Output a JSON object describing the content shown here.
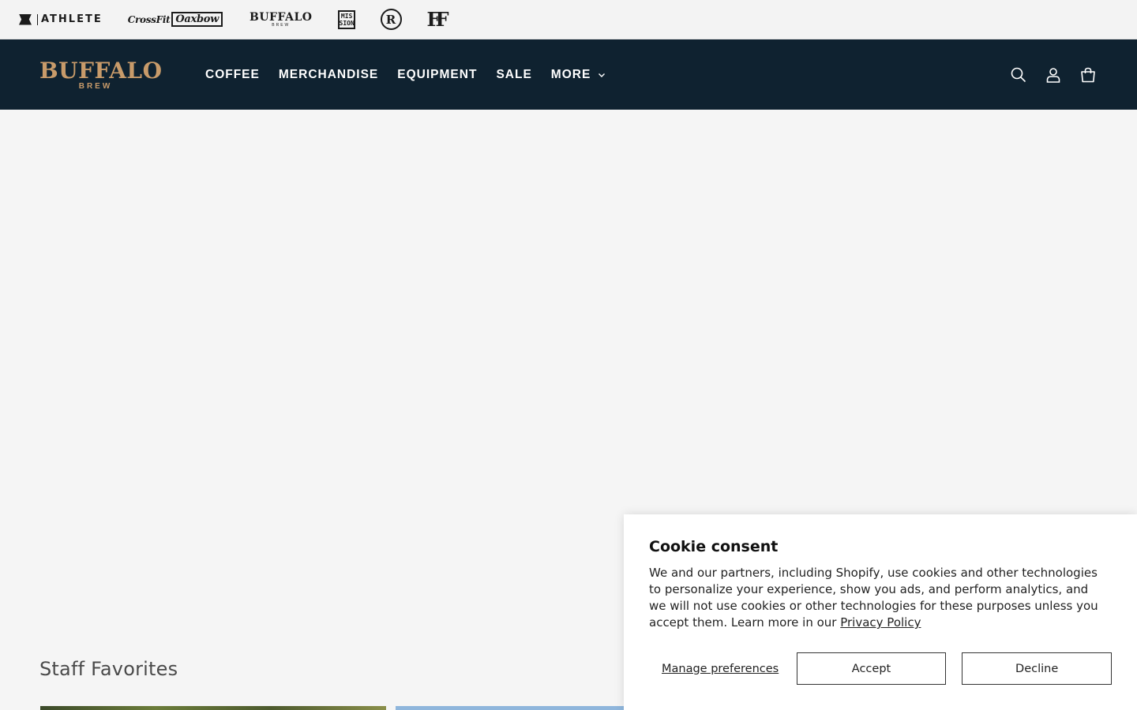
{
  "brands": {
    "athlete": "ATHLETE",
    "crossfit": "CrossFit",
    "crossfit_badge": "Oaxbow",
    "buffalo_top": "BUFFALO",
    "buffalo_bottom": "BREW",
    "mission": "MIS SION",
    "r": "R",
    "ff": "FF"
  },
  "header": {
    "logo_top": "BUFFALO",
    "logo_bottom": "BREW",
    "nav": [
      "COFFEE",
      "MERCHANDISE",
      "EQUIPMENT",
      "SALE",
      "MORE"
    ],
    "icons": [
      "search-icon",
      "account-icon",
      "cart-icon"
    ]
  },
  "section": {
    "title": "Staff Favorites"
  },
  "cookie": {
    "title": "Cookie consent",
    "body": "We and our partners, including Shopify, use cookies and other technologies to personalize your experience, show you ads, and perform analytics, and we will not use cookies or other technologies for these purposes unless you accept them. Learn more in our ",
    "link": "Privacy Policy",
    "manage": "Manage preferences",
    "accept": "Accept",
    "decline": "Decline"
  },
  "colors": {
    "header_bg": "#0f2230",
    "logo_gold": "#c89b6a",
    "page_bg": "#f5f5f5"
  }
}
